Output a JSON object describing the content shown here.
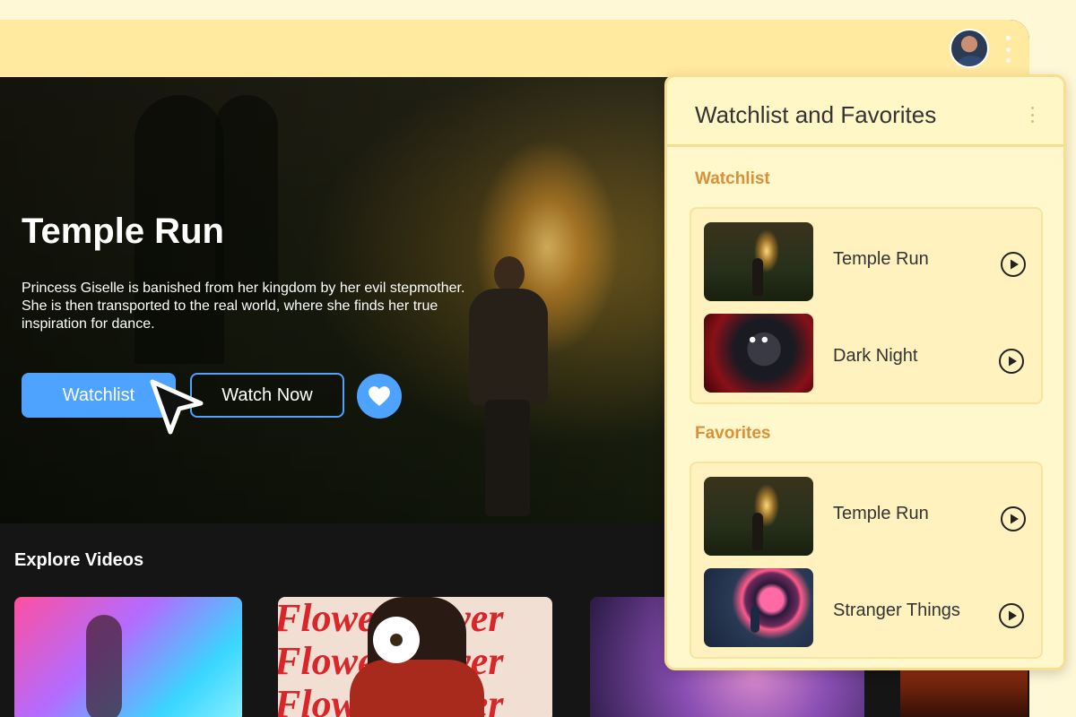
{
  "hero": {
    "title": "Temple Run",
    "description": "Princess Giselle is banished from her kingdom by her evil stepmother. She is then transported to the real world, where she finds her true inspiration for dance.",
    "watchlist_label": "Watchlist",
    "watch_now_label": "Watch Now"
  },
  "explore": {
    "title": "Explore Videos",
    "thumb2_text": [
      "Flower Power",
      "Flower Power",
      "Flower Power"
    ]
  },
  "panel": {
    "title": "Watchlist and Favorites",
    "watchlist": {
      "title": "Watchlist",
      "items": [
        {
          "title": "Temple Run"
        },
        {
          "title": "Dark Night"
        }
      ]
    },
    "favorites": {
      "title": "Favorites",
      "items": [
        {
          "title": "Temple Run"
        },
        {
          "title": "Stranger Things"
        }
      ]
    }
  },
  "icons": {
    "avatar": "user-avatar",
    "menu": "kebab-menu-icon",
    "favorite": "heart-icon",
    "play": "play-circle-icon",
    "cursor": "mouse-pointer-icon"
  },
  "colors": {
    "accent": "#4da3ff",
    "topbar": "#ffeaa0",
    "panel_bg": "#fff8cc",
    "panel_border": "#f9de92",
    "section_title": "#d8913a",
    "dark_bg": "#151515"
  }
}
